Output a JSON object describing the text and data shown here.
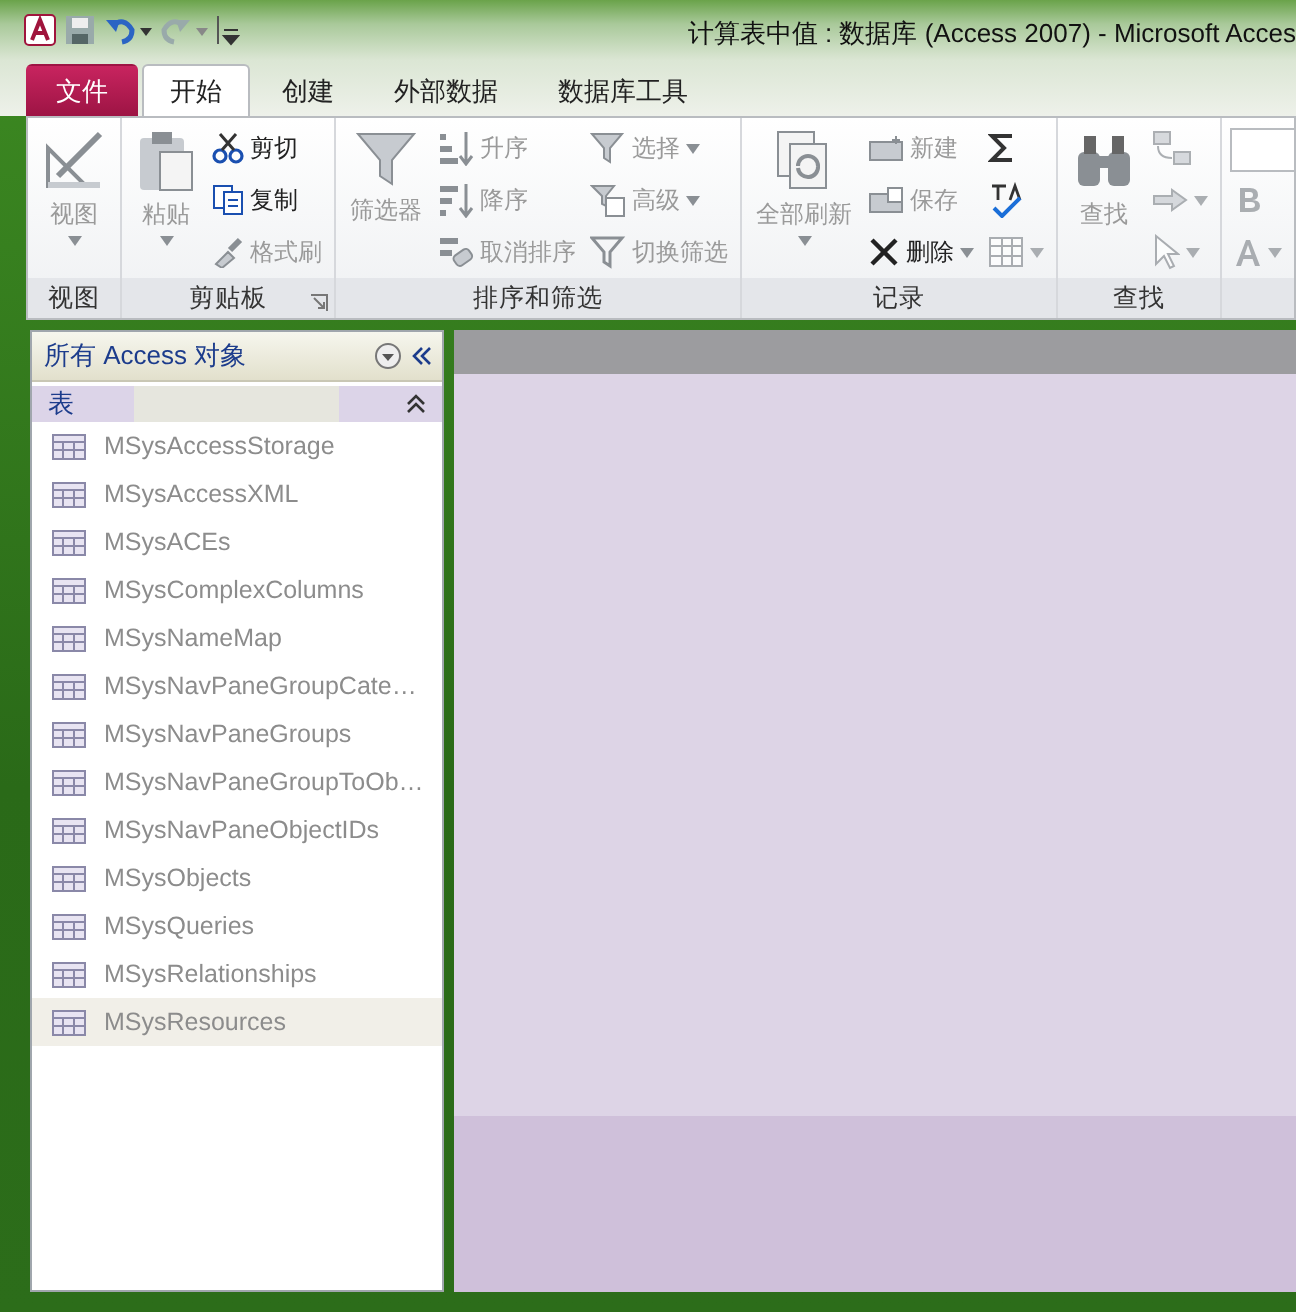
{
  "window": {
    "title": "计算表中值 : 数据库 (Access 2007)  -  Microsoft Acces"
  },
  "tabs": [
    {
      "label": "文件",
      "kind": "file",
      "selected": false
    },
    {
      "label": "开始",
      "kind": "tab",
      "selected": true
    },
    {
      "label": "创建",
      "kind": "tab",
      "selected": false
    },
    {
      "label": "外部数据",
      "kind": "tab",
      "selected": false
    },
    {
      "label": "数据库工具",
      "kind": "tab",
      "selected": false
    }
  ],
  "ribbon_groups": [
    {
      "label": "视图",
      "launcher": false,
      "columns": [
        [
          {
            "kind": "large",
            "label": "视图",
            "disabled": true,
            "dropdown": true
          }
        ]
      ]
    },
    {
      "label": "剪贴板",
      "launcher": true,
      "columns": [
        [
          {
            "kind": "large",
            "label": "粘贴",
            "disabled": true,
            "dropdown": true
          }
        ],
        [
          {
            "kind": "small",
            "label": "剪切",
            "disabled": false,
            "dropdown": false
          },
          {
            "kind": "small",
            "label": "复制",
            "disabled": false,
            "dropdown": false
          },
          {
            "kind": "small",
            "label": "格式刷",
            "disabled": true,
            "dropdown": false
          }
        ]
      ]
    },
    {
      "label": "排序和筛选",
      "launcher": false,
      "columns": [
        [
          {
            "kind": "large",
            "label": "筛选器",
            "disabled": true,
            "dropdown": false
          }
        ],
        [
          {
            "kind": "small",
            "label": "升序",
            "disabled": true,
            "dropdown": false
          },
          {
            "kind": "small",
            "label": "降序",
            "disabled": true,
            "dropdown": false
          },
          {
            "kind": "small",
            "label": "取消排序",
            "disabled": true,
            "dropdown": false
          }
        ],
        [
          {
            "kind": "small",
            "label": "选择",
            "disabled": true,
            "dropdown": true
          },
          {
            "kind": "small",
            "label": "高级",
            "disabled": true,
            "dropdown": true
          },
          {
            "kind": "small",
            "label": "切换筛选",
            "disabled": true,
            "dropdown": false
          }
        ]
      ]
    },
    {
      "label": "记录",
      "launcher": false,
      "columns": [
        [
          {
            "kind": "large",
            "label": "全部刷新",
            "disabled": true,
            "dropdown": true
          }
        ],
        [
          {
            "kind": "small",
            "label": "新建",
            "disabled": true,
            "dropdown": false
          },
          {
            "kind": "small",
            "label": "保存",
            "disabled": true,
            "dropdown": false
          },
          {
            "kind": "small",
            "label": "删除",
            "disabled": false,
            "dropdown": true
          }
        ],
        [
          {
            "kind": "small",
            "disabled": false,
            "dropdown": false
          },
          {
            "kind": "small",
            "disabled": false,
            "dropdown": false
          },
          {
            "kind": "small",
            "disabled": true,
            "dropdown": true
          }
        ]
      ]
    },
    {
      "label": "查找",
      "launcher": false,
      "columns": [
        [
          {
            "kind": "large",
            "label": "查找",
            "disabled": true,
            "dropdown": false
          }
        ],
        [
          {
            "kind": "small",
            "disabled": true,
            "dropdown": false
          },
          {
            "kind": "small",
            "disabled": true,
            "dropdown": true
          },
          {
            "kind": "small",
            "disabled": true,
            "dropdown": true
          }
        ]
      ]
    },
    {
      "launcher": false,
      "columns": [
        [
          {
            "kind": "field"
          },
          {
            "kind": "small",
            "disabled": true,
            "dropdown": false
          },
          {
            "kind": "small",
            "disabled": true,
            "dropdown": true
          }
        ]
      ]
    }
  ],
  "nav_pane": {
    "title": "所有 Access 对象",
    "group": {
      "label": "表",
      "expanded": true,
      "items": [
        {
          "label": "MSysAccessStorage",
          "selected": false
        },
        {
          "label": "MSysAccessXML",
          "selected": false
        },
        {
          "label": "MSysACEs",
          "selected": false
        },
        {
          "label": "MSysComplexColumns",
          "selected": false
        },
        {
          "label": "MSysNameMap",
          "selected": false
        },
        {
          "label": "MSysNavPaneGroupCate…",
          "selected": false
        },
        {
          "label": "MSysNavPaneGroups",
          "selected": false
        },
        {
          "label": "MSysNavPaneGroupToOb…",
          "selected": false
        },
        {
          "label": "MSysNavPaneObjectIDs",
          "selected": false
        },
        {
          "label": "MSysObjects",
          "selected": false
        },
        {
          "label": "MSysQueries",
          "selected": false
        },
        {
          "label": "MSysRelationships",
          "selected": false
        },
        {
          "label": "MSysResources",
          "selected": true
        }
      ]
    }
  }
}
